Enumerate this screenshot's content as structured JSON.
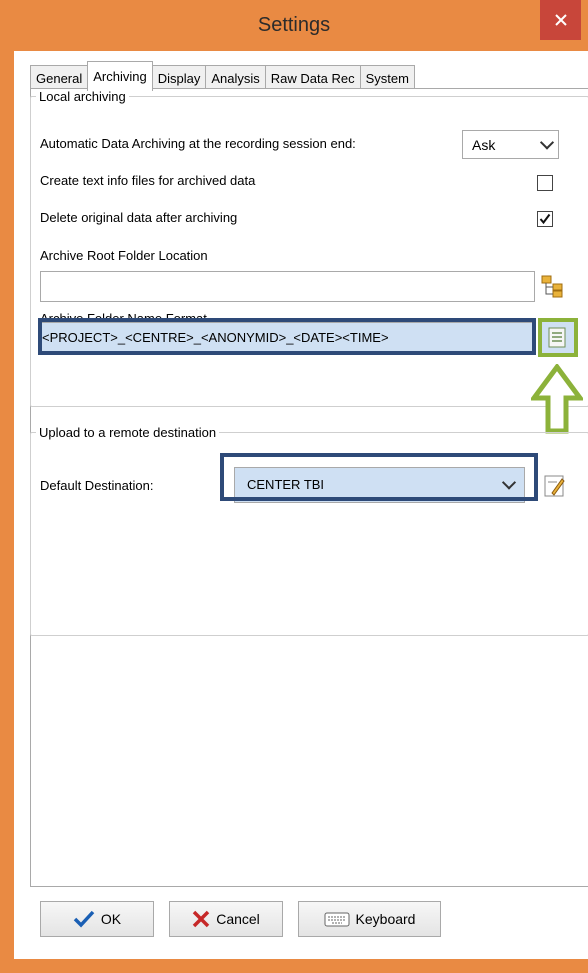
{
  "window": {
    "title": "Settings",
    "close": "×"
  },
  "tabs": [
    {
      "label": "General"
    },
    {
      "label": "Archiving"
    },
    {
      "label": "Display"
    },
    {
      "label": "Analysis"
    },
    {
      "label": "Raw Data Rec"
    },
    {
      "label": "System"
    }
  ],
  "local": {
    "group_title": "Local archiving",
    "auto_label": "Automatic Data Archiving at the recording session end:",
    "auto_value": "Ask",
    "text_info_label": "Create text info files for archived data",
    "text_info_checked": false,
    "delete_label": "Delete original data after archiving",
    "delete_checked": true,
    "root_label": "Archive Root Folder Location",
    "root_value": "",
    "format_label": "Archive Folder Name Format",
    "format_value": "<PROJECT>_<CENTRE>_<ANONYMID>_<DATE><TIME>"
  },
  "remote": {
    "group_title": "Upload to a remote destination",
    "dest_label": "Default Destination:",
    "dest_value": "CENTER TBI"
  },
  "buttons": {
    "ok": "OK",
    "cancel": "Cancel",
    "keyboard": "Keyboard"
  },
  "colors": {
    "title_bar": "#e98a43",
    "close_button": "#c8463a",
    "highlight_border": "#2e4a78",
    "field_highlight": "#cfe0f3",
    "arrow": "#8cb23a"
  },
  "icons": [
    "close-icon",
    "folder-tree-icon",
    "format-list-icon",
    "edit-icon",
    "checkmark-icon",
    "x-icon",
    "keyboard-icon",
    "arrow-up-icon"
  ]
}
